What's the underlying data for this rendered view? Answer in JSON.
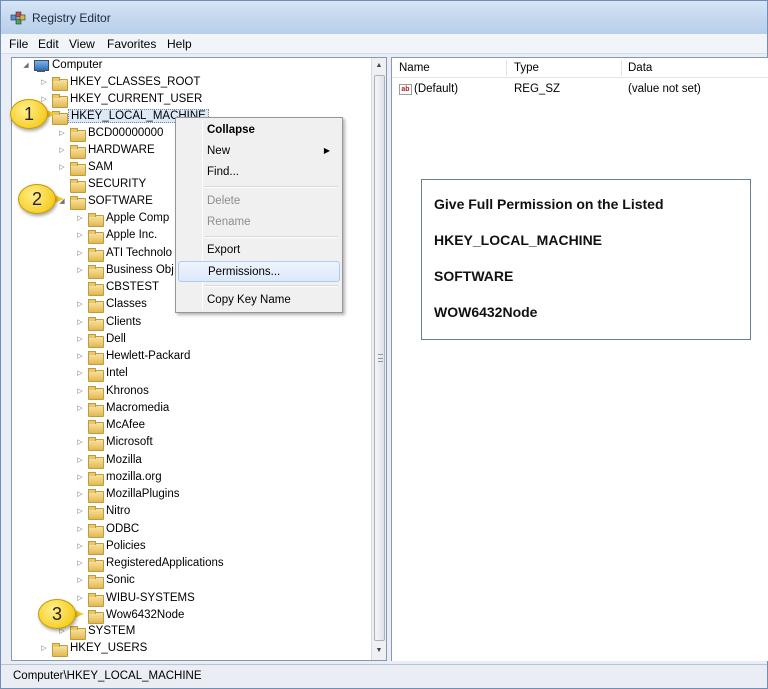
{
  "window": {
    "title": "Registry Editor"
  },
  "menu": [
    "File",
    "Edit",
    "View",
    "Favorites",
    "Help"
  ],
  "tree": {
    "computer": "Computer",
    "hkcr": "HKEY_CLASSES_ROOT",
    "hkcu": "HKEY_CURRENT_USER",
    "hklm": "HKEY_LOCAL_MACHINE",
    "hklm_children": [
      "BCD00000000",
      "HARDWARE",
      "SAM",
      "SECURITY",
      "SOFTWARE"
    ],
    "software_children": [
      "Apple Comp",
      "Apple Inc.",
      "ATI Technolo",
      "Business Obj",
      "CBSTEST",
      "Classes",
      "Clients",
      "Dell",
      "Hewlett-Packard",
      "Intel",
      "Khronos",
      "Macromedia",
      "McAfee",
      "Microsoft",
      "Mozilla",
      "mozilla.org",
      "MozillaPlugins",
      "Nitro",
      "ODBC",
      "Policies",
      "RegisteredApplications",
      "Sonic",
      "WIBU-SYSTEMS",
      "Wow6432Node"
    ],
    "system": "SYSTEM",
    "hku": "HKEY_USERS"
  },
  "values_list": {
    "headers": {
      "name": "Name",
      "type": "Type",
      "data": "Data"
    },
    "rows": [
      {
        "name": "(Default)",
        "type": "REG_SZ",
        "data": "(value not set)"
      }
    ]
  },
  "context_menu": {
    "collapse": "Collapse",
    "new": "New",
    "find": "Find...",
    "delete": "Delete",
    "rename": "Rename",
    "export": "Export",
    "permissions": "Permissions...",
    "copy_key_name": "Copy Key Name"
  },
  "note": {
    "line1": "Give Full Permission on the Listed",
    "line2": "HKEY_LOCAL_MACHINE",
    "line3": "SOFTWARE",
    "line4": "WOW6432Node"
  },
  "callouts": [
    "1",
    "2",
    "3"
  ],
  "status": "Computer\\HKEY_LOCAL_MACHINE",
  "colors": {
    "callout": "#f6cf2a",
    "selection": "#dde9f7",
    "menu_highlight": "#dde9f8"
  }
}
